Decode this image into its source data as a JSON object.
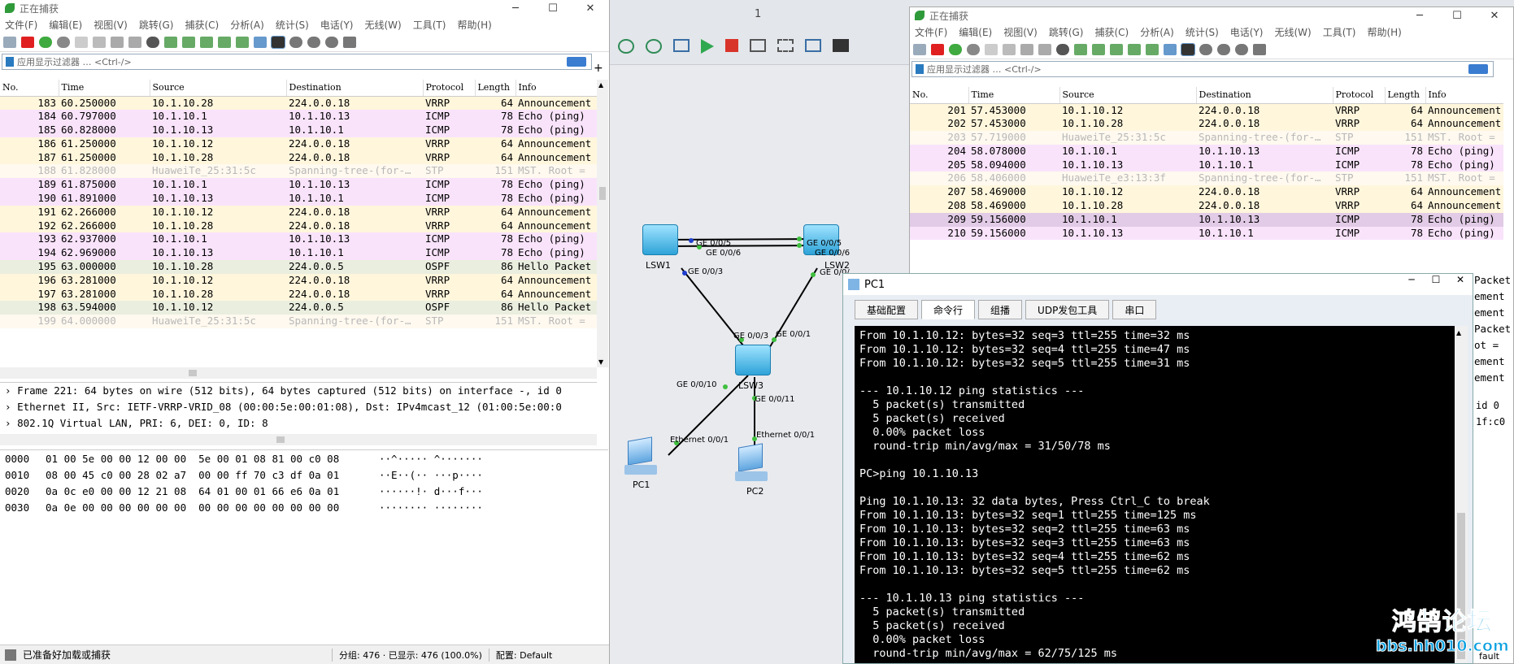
{
  "colors": {
    "vrrp": "#fff6dc",
    "icmp": "#f9e3fb",
    "ospf": "#eaeedf",
    "stp": "#fff9ef",
    "icmp_sel": "#e2cbe6"
  },
  "left": {
    "title": "正在捕获",
    "menu": [
      "文件(F)",
      "编辑(E)",
      "视图(V)",
      "跳转(G)",
      "捕获(C)",
      "分析(A)",
      "统计(S)",
      "电话(Y)",
      "无线(W)",
      "工具(T)",
      "帮助(H)"
    ],
    "filter_placeholder": "应用显示过滤器 … <Ctrl-/>",
    "columns": [
      "No.",
      "Time",
      "Source",
      "Destination",
      "Protocol",
      "Length",
      "Info"
    ],
    "rows": [
      {
        "no": "183",
        "time": "60.250000",
        "src": "10.1.10.28",
        "dst": "224.0.0.18",
        "proto": "VRRP",
        "len": "64",
        "info": "Announcement",
        "cls": "vrrp"
      },
      {
        "no": "184",
        "time": "60.797000",
        "src": "10.1.10.1",
        "dst": "10.1.10.13",
        "proto": "ICMP",
        "len": "78",
        "info": "Echo (ping)",
        "cls": "icmp"
      },
      {
        "no": "185",
        "time": "60.828000",
        "src": "10.1.10.13",
        "dst": "10.1.10.1",
        "proto": "ICMP",
        "len": "78",
        "info": "Echo (ping)",
        "cls": "icmp"
      },
      {
        "no": "186",
        "time": "61.250000",
        "src": "10.1.10.12",
        "dst": "224.0.0.18",
        "proto": "VRRP",
        "len": "64",
        "info": "Announcement",
        "cls": "vrrp"
      },
      {
        "no": "187",
        "time": "61.250000",
        "src": "10.1.10.28",
        "dst": "224.0.0.18",
        "proto": "VRRP",
        "len": "64",
        "info": "Announcement",
        "cls": "vrrp"
      },
      {
        "no": "188",
        "time": "61.828000",
        "src": "HuaweiTe_25:31:5c",
        "dst": "Spanning-tree-(for-…",
        "proto": "STP",
        "len": "151",
        "info": "MST. Root =",
        "cls": "stp"
      },
      {
        "no": "189",
        "time": "61.875000",
        "src": "10.1.10.1",
        "dst": "10.1.10.13",
        "proto": "ICMP",
        "len": "78",
        "info": "Echo (ping)",
        "cls": "icmp"
      },
      {
        "no": "190",
        "time": "61.891000",
        "src": "10.1.10.13",
        "dst": "10.1.10.1",
        "proto": "ICMP",
        "len": "78",
        "info": "Echo (ping)",
        "cls": "icmp"
      },
      {
        "no": "191",
        "time": "62.266000",
        "src": "10.1.10.12",
        "dst": "224.0.0.18",
        "proto": "VRRP",
        "len": "64",
        "info": "Announcement",
        "cls": "vrrp"
      },
      {
        "no": "192",
        "time": "62.266000",
        "src": "10.1.10.28",
        "dst": "224.0.0.18",
        "proto": "VRRP",
        "len": "64",
        "info": "Announcement",
        "cls": "vrrp"
      },
      {
        "no": "193",
        "time": "62.937000",
        "src": "10.1.10.1",
        "dst": "10.1.10.13",
        "proto": "ICMP",
        "len": "78",
        "info": "Echo (ping)",
        "cls": "icmp"
      },
      {
        "no": "194",
        "time": "62.969000",
        "src": "10.1.10.13",
        "dst": "10.1.10.1",
        "proto": "ICMP",
        "len": "78",
        "info": "Echo (ping)",
        "cls": "icmp"
      },
      {
        "no": "195",
        "time": "63.000000",
        "src": "10.1.10.28",
        "dst": "224.0.0.5",
        "proto": "OSPF",
        "len": "86",
        "info": "Hello Packet",
        "cls": "ospf"
      },
      {
        "no": "196",
        "time": "63.281000",
        "src": "10.1.10.12",
        "dst": "224.0.0.18",
        "proto": "VRRP",
        "len": "64",
        "info": "Announcement",
        "cls": "vrrp"
      },
      {
        "no": "197",
        "time": "63.281000",
        "src": "10.1.10.28",
        "dst": "224.0.0.18",
        "proto": "VRRP",
        "len": "64",
        "info": "Announcement",
        "cls": "vrrp"
      },
      {
        "no": "198",
        "time": "63.594000",
        "src": "10.1.10.12",
        "dst": "224.0.0.5",
        "proto": "OSPF",
        "len": "86",
        "info": "Hello Packet",
        "cls": "ospf"
      },
      {
        "no": "199",
        "time": "64.000000",
        "src": "HuaweiTe_25:31:5c",
        "dst": "Spanning-tree-(for-…",
        "proto": "STP",
        "len": "151",
        "info": "MST. Root =",
        "cls": "stp"
      }
    ],
    "details": [
      "Frame 221: 64 bytes on wire (512 bits), 64 bytes captured (512 bits) on interface -, id 0",
      "Ethernet II, Src: IETF-VRRP-VRID_08 (00:00:5e:00:01:08), Dst: IPv4mcast_12 (01:00:5e:00:0",
      "802.1Q Virtual LAN, PRI: 6, DEI: 0, ID: 8"
    ],
    "hex": [
      {
        "off": "0000",
        "bytes": "01 00 5e 00 00 12 00 00  5e 00 01 08 81 00 c0 08",
        "ascii": "··^····· ^·······"
      },
      {
        "off": "0010",
        "bytes": "08 00 45 c0 00 28 02 a7  00 00 ff 70 c3 df 0a 01",
        "ascii": "··E··(·· ···p····"
      },
      {
        "off": "0020",
        "bytes": "0a 0c e0 00 00 12 21 08  64 01 00 01 66 e6 0a 01",
        "ascii": "······!· d···f···"
      },
      {
        "off": "0030",
        "bytes": "0a 0e 00 00 00 00 00 00  00 00 00 00 00 00 00 00",
        "ascii": "········ ········"
      }
    ],
    "status_left": "已准备好加载或捕获",
    "status_groups": "分组: 476 · 已显示: 476 (100.0%)",
    "status_profile": "配置: Default"
  },
  "right": {
    "title": "正在捕获",
    "menu": [
      "文件(F)",
      "编辑(E)",
      "视图(V)",
      "跳转(G)",
      "捕获(C)",
      "分析(A)",
      "统计(S)",
      "电话(Y)",
      "无线(W)",
      "工具(T)",
      "帮助(H)"
    ],
    "filter_placeholder": "应用显示过滤器 … <Ctrl-/>",
    "columns": [
      "No.",
      "Time",
      "Source",
      "Destination",
      "Protocol",
      "Length",
      "Info"
    ],
    "rows": [
      {
        "no": "201",
        "time": "57.453000",
        "src": "10.1.10.12",
        "dst": "224.0.0.18",
        "proto": "VRRP",
        "len": "64",
        "info": "Announcement",
        "cls": "vrrp"
      },
      {
        "no": "202",
        "time": "57.453000",
        "src": "10.1.10.28",
        "dst": "224.0.0.18",
        "proto": "VRRP",
        "len": "64",
        "info": "Announcement",
        "cls": "vrrp"
      },
      {
        "no": "203",
        "time": "57.719000",
        "src": "HuaweiTe_25:31:5c",
        "dst": "Spanning-tree-(for-…",
        "proto": "STP",
        "len": "151",
        "info": "MST. Root =",
        "cls": "stp"
      },
      {
        "no": "204",
        "time": "58.078000",
        "src": "10.1.10.1",
        "dst": "10.1.10.13",
        "proto": "ICMP",
        "len": "78",
        "info": "Echo (ping)",
        "cls": "icmp"
      },
      {
        "no": "205",
        "time": "58.094000",
        "src": "10.1.10.13",
        "dst": "10.1.10.1",
        "proto": "ICMP",
        "len": "78",
        "info": "Echo (ping)",
        "cls": "icmp"
      },
      {
        "no": "206",
        "time": "58.406000",
        "src": "HuaweiTe_e3:13:3f",
        "dst": "Spanning-tree-(for-…",
        "proto": "STP",
        "len": "151",
        "info": "MST. Root =",
        "cls": "stp"
      },
      {
        "no": "207",
        "time": "58.469000",
        "src": "10.1.10.12",
        "dst": "224.0.0.18",
        "proto": "VRRP",
        "len": "64",
        "info": "Announcement",
        "cls": "vrrp"
      },
      {
        "no": "208",
        "time": "58.469000",
        "src": "10.1.10.28",
        "dst": "224.0.0.18",
        "proto": "VRRP",
        "len": "64",
        "info": "Announcement",
        "cls": "vrrp"
      },
      {
        "no": "209",
        "time": "59.156000",
        "src": "10.1.10.1",
        "dst": "10.1.10.13",
        "proto": "ICMP",
        "len": "78",
        "info": "Echo (ping)",
        "cls": "icmp_sel"
      },
      {
        "no": "210",
        "time": "59.156000",
        "src": "10.1.10.13",
        "dst": "10.1.10.1",
        "proto": "ICMP",
        "len": "78",
        "info": "Echo (ping)",
        "cls": "icmp"
      }
    ],
    "side_partial": [
      "Packet",
      "ement",
      "ement",
      "Packet",
      "ot =",
      "ement",
      "ement"
    ],
    "detail_partial": [
      "id 0",
      "1f:c0"
    ],
    "status_partial": "fault"
  },
  "ensp": {
    "tab_number": "1",
    "devices": [
      "LSW1",
      "LSW2",
      "LSW3",
      "PC1",
      "PC2"
    ],
    "ports": {
      "lsw1_a": "GE 0/0/5",
      "lsw1_b": "GE 0/0/6",
      "lsw1_c": "GE 0/0/3",
      "lsw2_a": "GE 0/0/5",
      "lsw2_b": "GE 0/0/6",
      "lsw2_c": "GE 0/0/",
      "lsw3_a": "GE 0/0/3",
      "lsw3_b": "GE 0/0/1",
      "lsw3_c": "GE 0/0/10",
      "lsw3_d": "GE 0/0/11",
      "pc1": "Ethernet 0/0/1",
      "pc2": "Ethernet 0/0/1"
    }
  },
  "pc1": {
    "title": "PC1",
    "tabs": [
      "基础配置",
      "命令行",
      "组播",
      "UDP发包工具",
      "串口"
    ],
    "active_tab": "命令行",
    "lines": [
      "From 10.1.10.12: bytes=32 seq=3 ttl=255 time=32 ms",
      "From 10.1.10.12: bytes=32 seq=4 ttl=255 time=47 ms",
      "From 10.1.10.12: bytes=32 seq=5 ttl=255 time=31 ms",
      "",
      "--- 10.1.10.12 ping statistics ---",
      "  5 packet(s) transmitted",
      "  5 packet(s) received",
      "  0.00% packet loss",
      "  round-trip min/avg/max = 31/50/78 ms",
      "",
      "PC>ping 10.1.10.13",
      "",
      "Ping 10.1.10.13: 32 data bytes, Press Ctrl_C to break",
      "From 10.1.10.13: bytes=32 seq=1 ttl=255 time=125 ms",
      "From 10.1.10.13: bytes=32 seq=2 ttl=255 time=63 ms",
      "From 10.1.10.13: bytes=32 seq=3 ttl=255 time=63 ms",
      "From 10.1.10.13: bytes=32 seq=4 ttl=255 time=62 ms",
      "From 10.1.10.13: bytes=32 seq=5 ttl=255 time=62 ms",
      "",
      "--- 10.1.10.13 ping statistics ---",
      "  5 packet(s) transmitted",
      "  5 packet(s) received",
      "  0.00% packet loss",
      "  round-trip min/avg/max = 62/75/125 ms"
    ]
  },
  "watermark": {
    "cn": "鸿鹄论坛",
    "url": "bbs.hh010.com"
  }
}
